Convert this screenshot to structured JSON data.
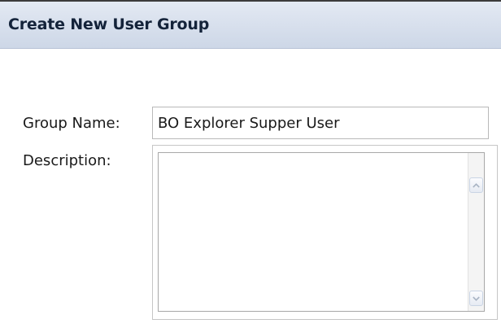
{
  "header": {
    "title": "Create New User Group"
  },
  "form": {
    "group_name_label": "Group Name:",
    "group_name_value": "BO Explorer Supper User",
    "description_label": "Description:",
    "description_value": ""
  },
  "icons": {
    "scroll_up": "chevron-up-icon",
    "scroll_down": "chevron-down-icon"
  },
  "colors": {
    "header_bg_top": "#e3e9f3",
    "header_bg_bottom": "#cdd7e7",
    "header_text": "#14233a",
    "top_rule": "#3b3b3b"
  }
}
